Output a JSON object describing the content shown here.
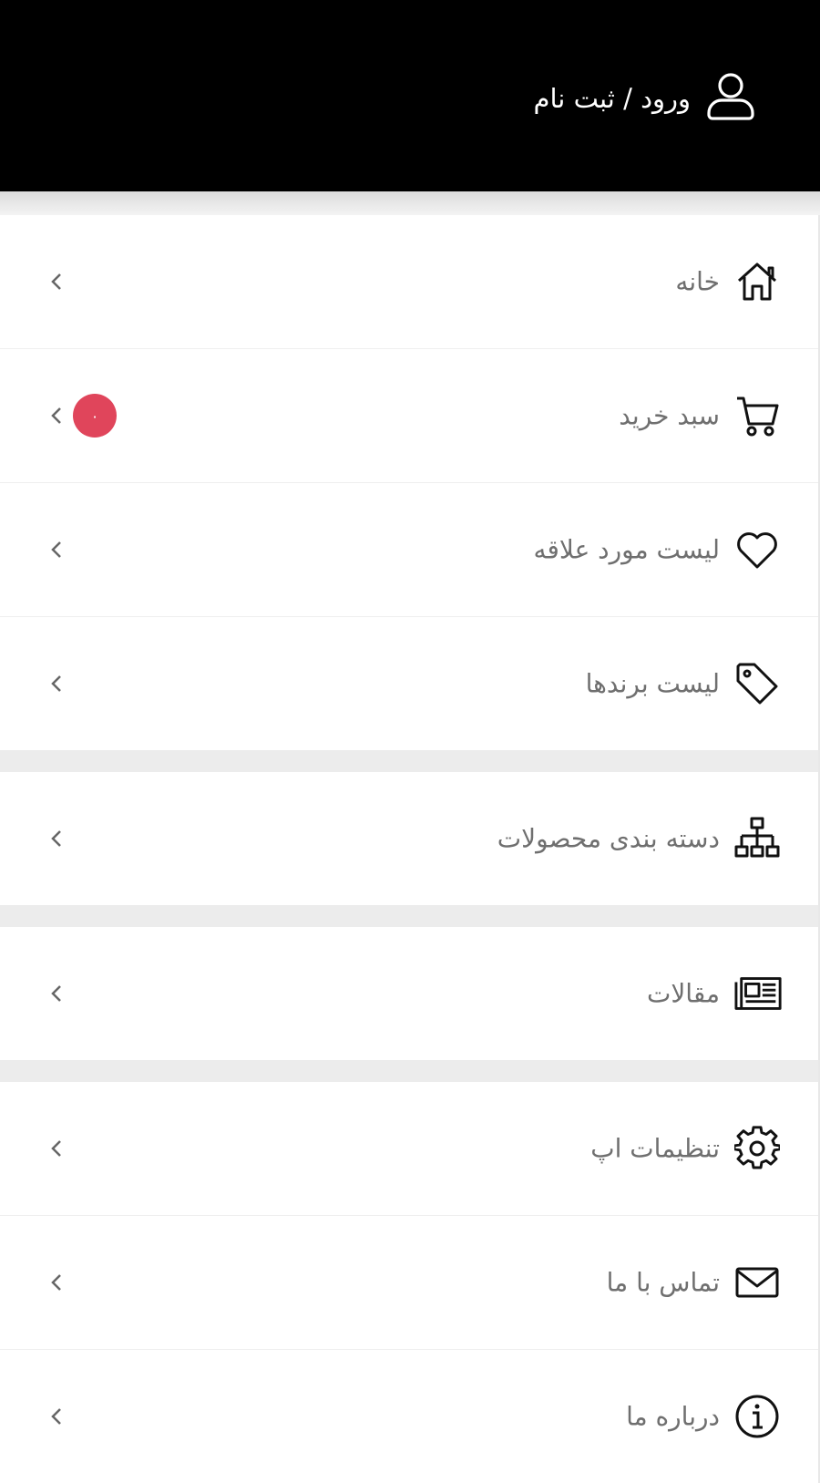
{
  "header": {
    "login_label": "ورود / ثبت نام",
    "icon": "user-icon"
  },
  "colors": {
    "header_bg": "#000000",
    "badge": "#e0455b",
    "label_text": "#6f6f6f"
  },
  "menu": {
    "home": {
      "label": "خانه",
      "icon": "home-icon"
    },
    "cart": {
      "label": "سبد خرید",
      "icon": "cart-icon",
      "badge": "۰"
    },
    "wishlist": {
      "label": "لیست مورد علاقه",
      "icon": "heart-icon"
    },
    "brands": {
      "label": "لیست برندها",
      "icon": "tag-icon"
    },
    "categories": {
      "label": "دسته بندی محصولات",
      "icon": "sitemap-icon"
    },
    "articles": {
      "label": "مقالات",
      "icon": "newspaper-icon"
    },
    "settings": {
      "label": "تنظیمات اپ",
      "icon": "gear-icon"
    },
    "contact": {
      "label": "تماس با ما",
      "icon": "envelope-icon"
    },
    "about": {
      "label": "درباره ما",
      "icon": "info-icon"
    }
  }
}
